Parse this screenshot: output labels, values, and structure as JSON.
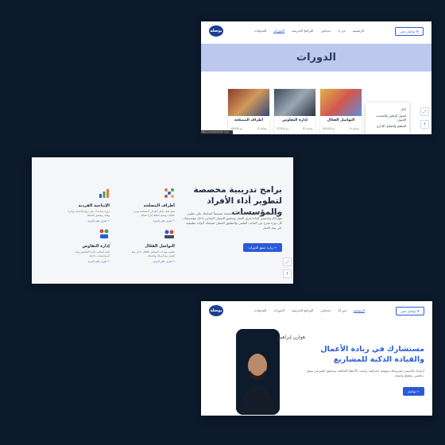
{
  "nav": {
    "logo": "بوصلة",
    "items1": [
      "الرئيسية",
      "من نا",
      "خدماتي",
      "البرامج التدريبية",
      "الدورات",
      "المدونات"
    ],
    "items3": [
      "الرئيسية",
      "من أنا",
      "خدماتي",
      "البرامج التدريبية",
      "الدورات",
      "المدونات"
    ],
    "cta": "تواصل معي ✉"
  },
  "courses_page": {
    "banner_title": "الدورات",
    "dropdown": [
      "الكل",
      "لتحول الرقمي والتحديث الحيوي",
      "التنظيم والتحليل الإداري"
    ],
    "cards": [
      {
        "title": "التواصل الفعّال",
        "price": "50000 دع",
        "seats": "8 مقاعد"
      },
      {
        "title": "إدارة التفاوض",
        "price": "37500 دع",
        "seats": "10 مقاعد"
      },
      {
        "title": "أطراف المصلحة",
        "price": "10000 دع",
        "seats": "6 مقاعد"
      }
    ],
    "url": "https://madaredah.com"
  },
  "programs": {
    "heading": "برامج تدريبية مخصصة لتطوير أداء الأفراد والمؤسسات",
    "paragraph": "أقدّم لك باقة من الدورات العملية المتخصصة تصميماً لتمكينك على تطوير مهاراتك وتحسين كفاءة فرق العمل وتحقيق التحول الإيجابي داخل مؤسستك. كل دورة تمزج بين الجانب العلمي والتطبيق العملي لتمنحك أدوات تطبيقية في بيئة العمل.",
    "button": "زيارة جميع الدورات ←",
    "features": [
      {
        "title": "أطراف المصلحة",
        "desc": "تعلم كيف تحلل أطراف المصلحة وتبني علاقات وتضع خطط إدارة فعالة",
        "link": "تعرف على المزيد ←"
      },
      {
        "title": "الإنتاجية الفردية",
        "desc": "دورة تساعدك على رفع إنتاجيتك وإدارة وقتك وتحقيق أهدافك",
        "link": "تعرف على المزيد ←"
      },
      {
        "title": "التواصل الفعّال",
        "desc": "تطوير مهارات التواصل الفعّال داخل بيئة العمل مع الزملاء والعملاء",
        "link": "تعرف على المزيد ←"
      },
      {
        "title": "إدارة التفاوض",
        "desc": "تعلم أساليب إدارة التفاوض وبناء استراتيجيات ناجحة",
        "link": "تعرف على المزيد ←"
      }
    ]
  },
  "hero": {
    "name": "هوازن إبراهيم",
    "title": "مستشارك في ريادة الأعمال والقيادة الذكية للمشاريع",
    "paragraph": "أرشدك لتأسيس مشروعك بمنهجية احترافية، وتجنب الأخطاء المكلفة، وتحقيق النمو في سوق تنافسي بخطط واضحة.",
    "button": "تواصل ←"
  }
}
